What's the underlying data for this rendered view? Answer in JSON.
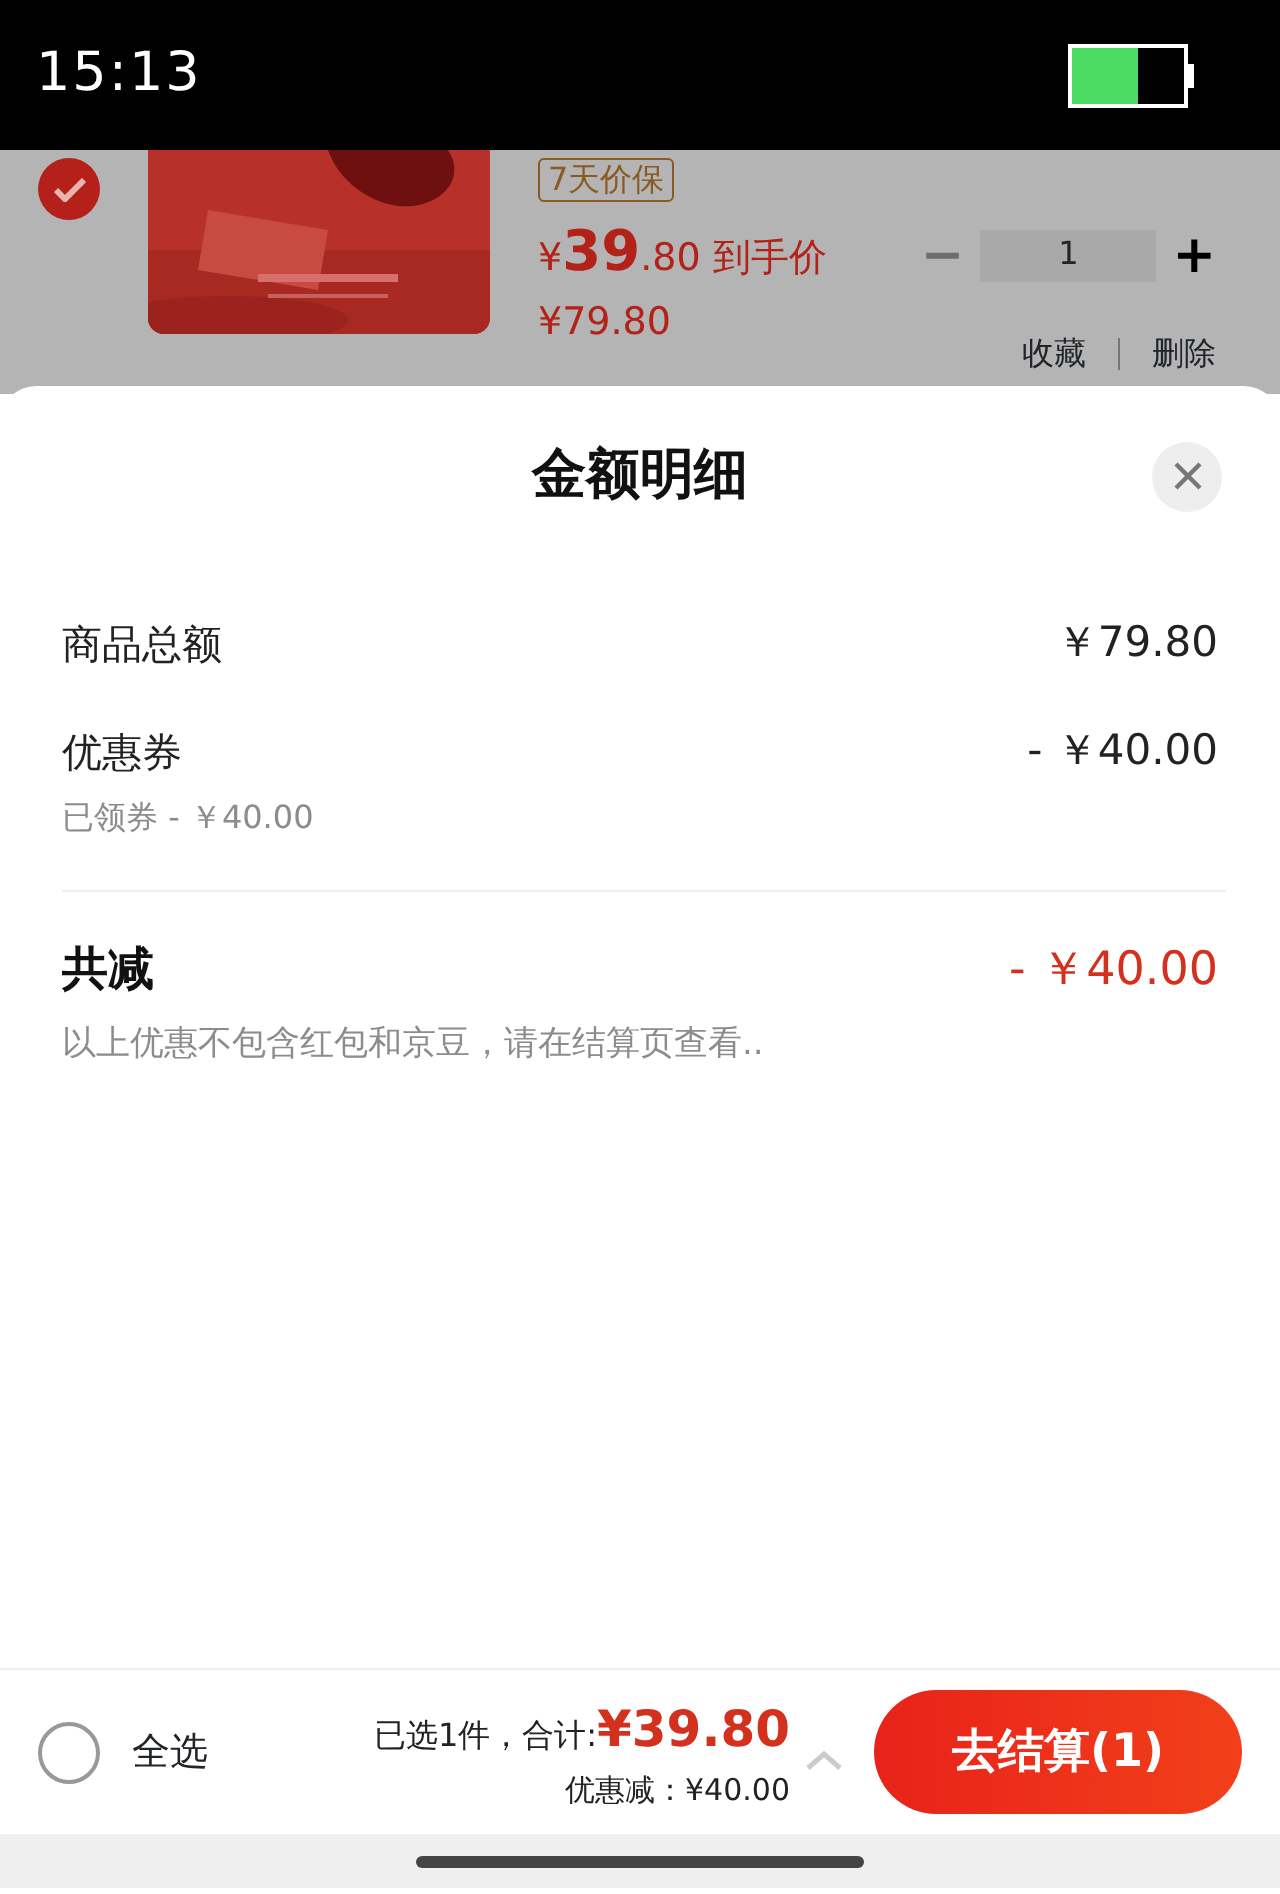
{
  "status_bar": {
    "time": "15:13"
  },
  "cart_item": {
    "checked": true,
    "tag": "7天价保",
    "price": "¥39.80",
    "price_label": "到手价",
    "original_price": "¥79.80",
    "quantity": "1",
    "minus": {
      "label": "−",
      "disabled": true
    },
    "plus": {
      "label": "+",
      "disabled": false
    },
    "actions": [
      "收藏",
      "删除"
    ]
  },
  "sheet": {
    "title": "金额明细",
    "rows": [
      {
        "label": "商品总额",
        "value": "￥79.80"
      },
      {
        "label": "优惠券",
        "value": "- ￥40.00",
        "note": "已领券 - ￥40.00"
      }
    ],
    "total": {
      "label": "共减",
      "value": "- ￥40.00"
    },
    "footnote": "以上优惠不包含红包和京豆，请在结算页查看.."
  },
  "footer": {
    "select_all": {
      "label": "全选",
      "checked": false
    },
    "summary": "已选1件，合计:",
    "total": "¥39.80",
    "discount": "优惠减：¥40.00",
    "checkout": "去结算(1)"
  }
}
